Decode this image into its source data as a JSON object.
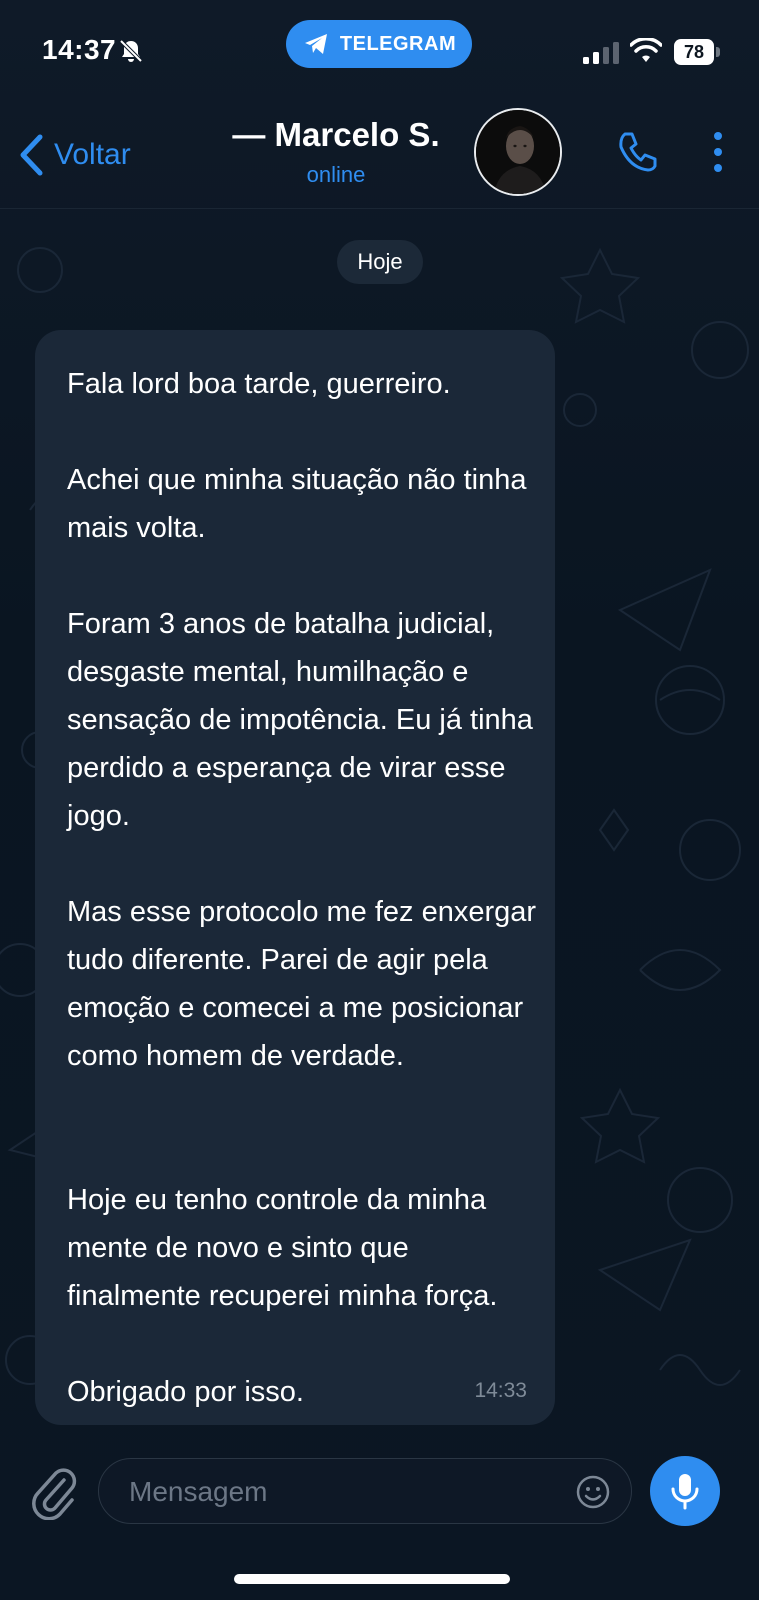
{
  "status_bar": {
    "time": "14:37",
    "mute_icon": "bell-slash-icon",
    "active_app_label": "TELEGRAM",
    "battery_level": "78",
    "signal_icon": "cellular-signal-icon",
    "wifi_icon": "wifi-icon"
  },
  "header": {
    "back_label": "Voltar",
    "contact_name": "— Marcelo S.",
    "contact_status": "online",
    "call_icon": "phone-icon",
    "menu_icon": "more-vertical-icon"
  },
  "chat": {
    "date_label": "Hoje",
    "message": {
      "paragraphs": [
        "Fala lord boa tarde, guerreiro.",
        "Achei que minha situação não tinha mais volta.",
        "Foram 3 anos de batalha judicial, desgaste mental, humilhação e sensação de impotência. Eu já tinha perdido a esperança de virar esse jogo.",
        "Mas esse protocolo me fez enxergar tudo diferente. Parei de agir pela emoção e comecei a me posicionar como homem de verdade.",
        "Hoje eu tenho controle da minha mente de novo e sinto que finalmente recuperei minha força.",
        "Obrigado por isso."
      ],
      "time": "14:33"
    }
  },
  "input_bar": {
    "placeholder": "Mensagem",
    "attach_icon": "paperclip-icon",
    "sticker_icon": "smiley-icon",
    "mic_icon": "microphone-icon"
  },
  "colors": {
    "accent": "#2f8df0",
    "background": "#0b1624",
    "bubble": "#1b2838",
    "text": "#ffffff",
    "muted_text": "#7f8b98"
  }
}
